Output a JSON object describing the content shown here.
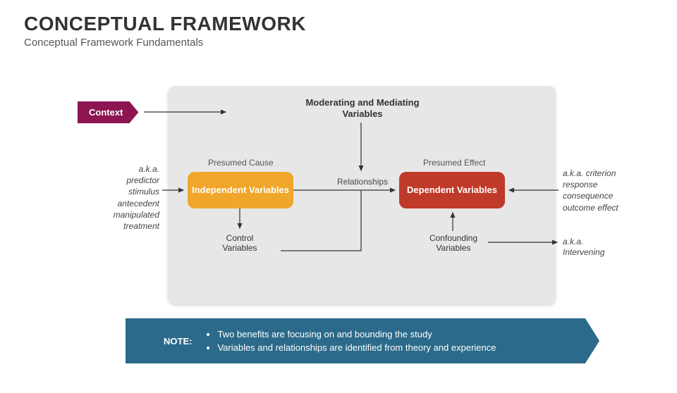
{
  "title": "CONCEPTUAL FRAMEWORK",
  "subtitle": "Conceptual Framework Fundamentals",
  "context_label": "Context",
  "moderating_label": "Moderating and Mediating Variables",
  "presumed_cause": "Presumed Cause",
  "presumed_effect": "Presumed Effect",
  "relationships": "Relationships",
  "independent_box": "Independent Variables",
  "dependent_box": "Dependent Variables",
  "control_variables": "Control Variables",
  "confounding_variables": "Confounding Variables",
  "aka_left": {
    "line1": "a.k.a.",
    "line2": "predictor",
    "line3": "stimulus",
    "line4": "antecedent",
    "line5": "manipulated",
    "line6": "treatment"
  },
  "aka_right": {
    "line1": "a.k.a. criterion",
    "line2": "response",
    "line3": "consequence",
    "line4": "outcome effect"
  },
  "aka_intervening": {
    "line1": "a.k.a.",
    "line2": "Intervening"
  },
  "note": {
    "label": "NOTE:",
    "bullet1": "Two benefits are focusing on and bounding the study",
    "bullet2": "Variables and relationships are identified from theory and experience"
  }
}
